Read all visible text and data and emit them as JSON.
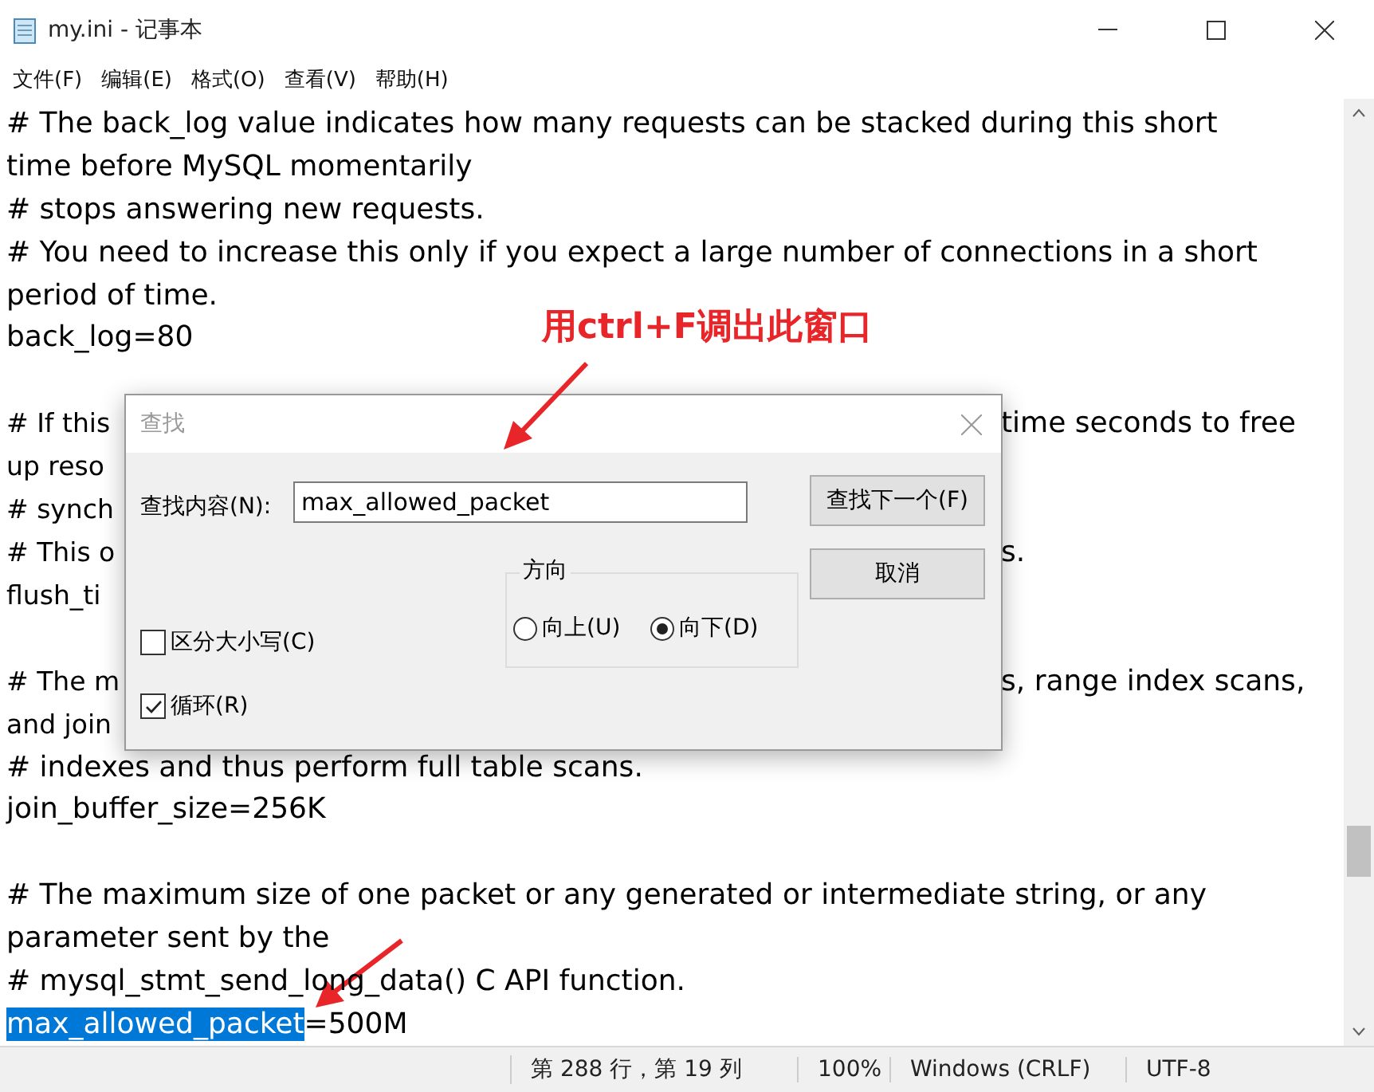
{
  "window": {
    "title": "my.ini - 记事本"
  },
  "menu": [
    "文件(F)",
    "编辑(E)",
    "格式(O)",
    "查看(V)",
    "帮助(H)"
  ],
  "lines": [
    {
      "kind": "plain",
      "text": "# The back_log value indicates how many requests can be stacked during this short"
    },
    {
      "kind": "plain",
      "text": "time before MySQL momentarily"
    },
    {
      "kind": "plain",
      "text": "# stops answering new requests."
    },
    {
      "kind": "plain",
      "text": "# You need to increase this only if you expect a large number of connections in a short"
    },
    {
      "kind": "plain",
      "text": "period of time."
    },
    {
      "kind": "plain",
      "text": "back_log=80"
    },
    {
      "kind": "blank"
    },
    {
      "kind": "split",
      "left": "# If this",
      "right": "time seconds to free"
    },
    {
      "kind": "split",
      "left": "up reso"
    },
    {
      "kind": "split",
      "left": "# synch"
    },
    {
      "kind": "split",
      "left": "# This o",
      "right": "s."
    },
    {
      "kind": "split",
      "left": "flush_ti"
    },
    {
      "kind": "blank"
    },
    {
      "kind": "split",
      "left": "# The m",
      "right": "s, range index scans,"
    },
    {
      "kind": "split",
      "left": "and join"
    },
    {
      "kind": "plain",
      "text": "# indexes and thus perform full table scans."
    },
    {
      "kind": "plain",
      "text": "join_buffer_size=256K"
    },
    {
      "kind": "blank"
    },
    {
      "kind": "plain",
      "text": "# The maximum size of one packet or any generated or intermediate string, or any"
    },
    {
      "kind": "plain",
      "text": "parameter sent by the"
    },
    {
      "kind": "plain",
      "text": "# mysql_stmt_send_long_data() C API function."
    },
    {
      "kind": "selected",
      "selection": "max_allowed_packet",
      "text": "=500M"
    }
  ],
  "status_bar": [
    "第 288 行，第 19 列",
    "100%",
    "Windows (CRLF)",
    "UTF-8"
  ],
  "dialog": {
    "title": "查找",
    "find_label": "查找内容(N):",
    "find_value": "max_allowed_packet",
    "buttons": [
      "查找下一个(F)",
      "取消"
    ],
    "direction": {
      "title": "方向",
      "options": [
        {
          "label": "向上(U)",
          "selected": false
        },
        {
          "label": "向下(D)",
          "selected": true
        }
      ]
    },
    "checkboxes": [
      {
        "label": "区分大小写(C)",
        "checked": false
      },
      {
        "label": "循环(R)",
        "checked": true
      }
    ]
  },
  "annotation": "用ctrl+F调出此窗口"
}
